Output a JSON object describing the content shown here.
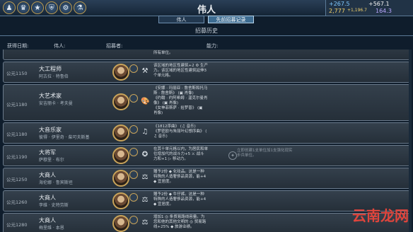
{
  "topbar": {
    "title": "伟人",
    "icons": [
      "people-icon",
      "crown-icon",
      "star-icon",
      "shield-icon",
      "gear-icon",
      "lab-icon"
    ],
    "icon_glyphs": [
      "♟",
      "♛",
      "★",
      "⛨",
      "⚙",
      "⚗"
    ]
  },
  "resources": {
    "science": "+267.5",
    "faith": "+567.1",
    "gold": "2,777",
    "gold_rate": "+1,196.7",
    "other": "164.3"
  },
  "tabs": [
    {
      "label": "伟人",
      "active": false
    },
    {
      "label": "先前招募记录",
      "active": true
    }
  ],
  "subtitle": "招募历史",
  "columns": {
    "date": "获得日期:",
    "person": "伟人:",
    "recruiter": "招募者:",
    "effect": "能力:"
  },
  "rows": [
    {
      "date": "",
      "great": "",
      "person": "",
      "ability": "",
      "desc": "所有单位。",
      "desc2": ""
    },
    {
      "date": "公元1150",
      "great": "大工程师",
      "person": "阿古拉 · 特鲁伯",
      "ability": "⚒",
      "desc": "该区域的地区性建筑+2 ⚙ 生产\n力。该区域的地区性建筑延伸3\n个单元格。",
      "desc2": ""
    },
    {
      "date": "公元1180",
      "great": "大艺术家",
      "person": "安吉丽卡 · 考夫曼",
      "ability": "🎨",
      "desc": "《安娜 · 玛丽亚 · 詹舍斯和托马\n斯 · 詹舍斯》 (▣ 肖像)\n《约翰 · 约阿希姆 · 温克尔曼肖\n像》 (▣ 肖像)\n《女神菲斯萨 · 拾罗普》 (▣\n肖像)",
      "desc2": ""
    },
    {
      "date": "公元1180",
      "great": "大音乐家",
      "person": "彼得 · 伊里奇 · 柴可夫斯基",
      "ability": "♫",
      "desc": "《1812序曲》 (♫ 音乐)\n《罗密欧与朱丽叶幻想序曲》 (\n♫ 音乐)",
      "desc2": ""
    },
    {
      "date": "公元1190",
      "great": "大将军",
      "person": "萨穆里 · 布尔",
      "ability": "✪",
      "desc": "在其十单元格以内，为居民和单\n位增加代的战斗力+5 ⚔ 战斗\n力和+1 ▷ 移动力。",
      "desc2": "立即创建1支单位加1支强化现实\n步兵单位。",
      "ability2": "✦"
    },
    {
      "date": "公元1250",
      "great": "大商人",
      "person": "海伦娜 · 鲁宾斯坦",
      "ability": "⚖",
      "desc": "赠予2份 ◆ 化妆品。这是一种\n特殊的人造奢侈品资源，能+4\n◆ 宜居度。",
      "desc2": ""
    },
    {
      "date": "公元1260",
      "great": "大商人",
      "person": "李维 · 史特劳斯",
      "ability": "⚖",
      "desc": "赠予2份 ◆ 牛仔裤。这是一种\n特殊的人造奢侈品资源，能+4\n◆ 宜居度。",
      "desc2": ""
    },
    {
      "date": "公元1280",
      "great": "大商人",
      "person": "梅里维 · 本恩",
      "ability": "⚖",
      "desc": "增加1 ◎ 条贸易路线容量。为\n您和他的其他文明的 ◎ 贸易路\n线+25% ◆ 旅游业绩。",
      "desc2": ""
    }
  ],
  "watermark": {
    "text": "云南龙网"
  }
}
